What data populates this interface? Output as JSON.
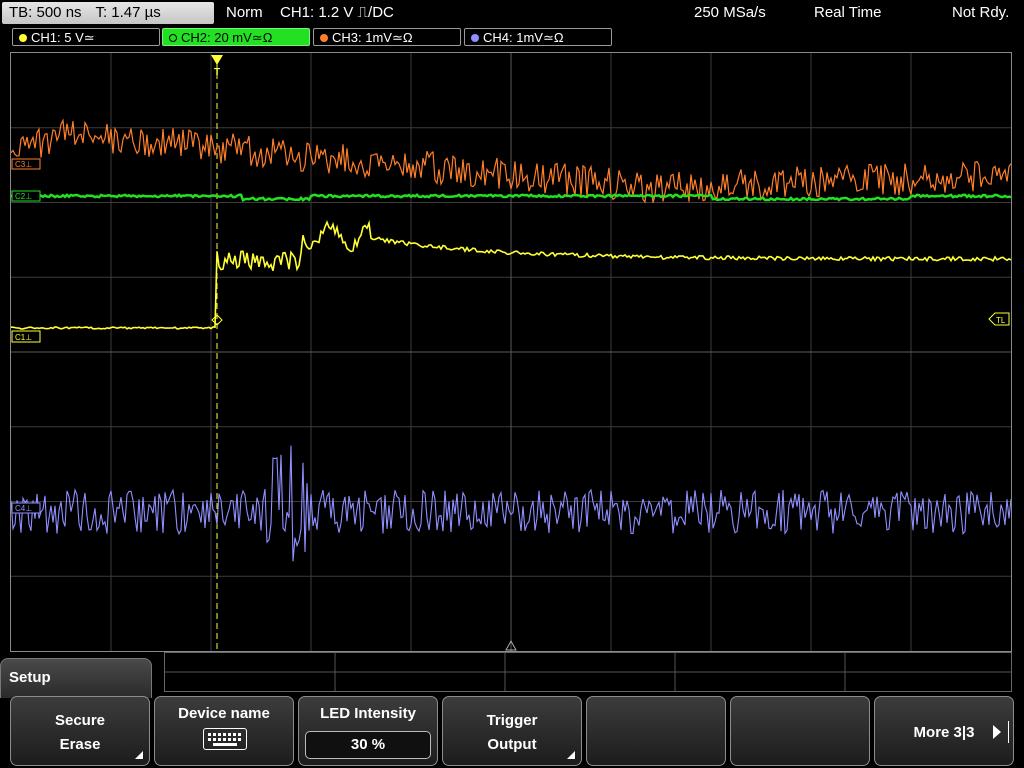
{
  "status": {
    "timebase": "TB: 500 ns",
    "trigger_time": "T: 1.47 µs",
    "mode": "Norm",
    "trigger_info": "CH1: 1.2 V ⎍/DC",
    "sample_rate": "250 MSa/s",
    "acq_mode": "Real Time",
    "state": "Not Rdy."
  },
  "channels": [
    {
      "label": "CH1: 5 V≃",
      "color": "#ffff33",
      "active": false
    },
    {
      "label": "CH2: 20 mV≃Ω",
      "color": "#22e022",
      "active": true
    },
    {
      "label": "CH3: 1mV≃Ω",
      "color": "#ff7f2a",
      "active": false
    },
    {
      "label": "CH4: 1mV≃Ω",
      "color": "#8f8fff",
      "active": false
    }
  ],
  "markers": {
    "c1": "C1⊥",
    "c2": "C2⊥",
    "c3": "C3⊥",
    "c4": "C4⊥",
    "trigger_level": "TL",
    "trigger_pos": "T"
  },
  "menu": {
    "setup_tab": "Setup",
    "softkeys": [
      {
        "line1": "Secure",
        "line2": "Erase"
      },
      {
        "line1": "Device name",
        "icon": "keyboard-icon"
      },
      {
        "line1": "LED Intensity",
        "value": "30 %"
      },
      {
        "line1": "Trigger",
        "line2": "Output"
      },
      {
        "line1": ""
      },
      {
        "line1": ""
      },
      {
        "line1": "More 3|3"
      }
    ]
  },
  "colors": {
    "ch1": "#ffff33",
    "ch2": "#22e022",
    "ch3": "#ff7f2a",
    "ch4": "#8f8fff",
    "grid": "#5a5a5a"
  }
}
